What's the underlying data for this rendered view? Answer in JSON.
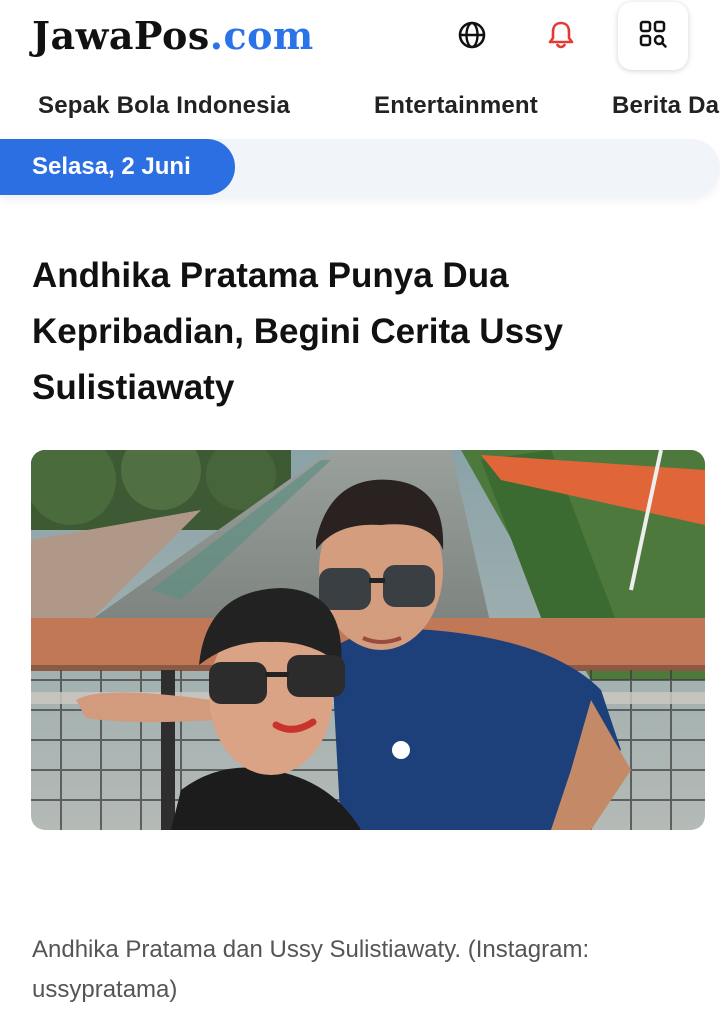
{
  "header": {
    "logo_main": "JawaPos",
    "logo_suffix": ".com",
    "icons": [
      "globe-icon",
      "bell-icon",
      "grid-search-icon"
    ],
    "accent_color": "#2a73e8",
    "bell_color": "#e53935"
  },
  "nav": {
    "items": [
      "Sepak Bola Indonesia",
      "Entertainment",
      "Berita Da"
    ]
  },
  "date_bar": {
    "label": "Selasa, 2 Juni",
    "color": "#2b6fe3"
  },
  "article": {
    "title": "Andhika Pratama Punya Dua Kepribadian, Begini Cerita Ussy Sulistiawaty",
    "caption": "Andhika Pratama dan Ussy Sulistiawaty. (Instagram: ussypratama)"
  }
}
